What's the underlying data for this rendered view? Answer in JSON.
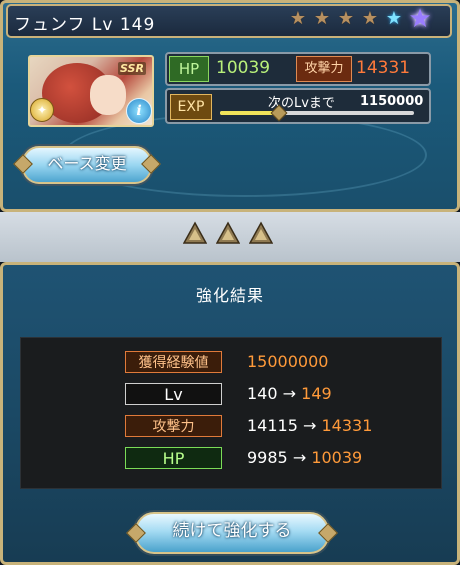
{
  "character": {
    "name": "フュンフ Lv 149",
    "rarity_badge": "SSR",
    "element_icon": "light-orb-icon",
    "info_icon_label": "i"
  },
  "stars": [
    {
      "type": "bronze",
      "glyph": "★"
    },
    {
      "type": "bronze",
      "glyph": "★"
    },
    {
      "type": "bronze",
      "glyph": "★"
    },
    {
      "type": "bronze",
      "glyph": "★"
    },
    {
      "type": "blue",
      "glyph": "★"
    },
    {
      "type": "purple",
      "glyph": "★"
    }
  ],
  "stats": {
    "hp_label": "HP",
    "hp_value": "10039",
    "atk_label": "攻撃力",
    "atk_value": "14331",
    "exp_label": "EXP",
    "next_label": "次のLvまで",
    "next_value": "1150000",
    "exp_progress": 0.3
  },
  "buttons": {
    "base_change": "ベース変更",
    "continue": "続けて強化する"
  },
  "result": {
    "title": "強化結果",
    "rows": [
      {
        "label": "獲得経験値",
        "before": "",
        "after": "15000000"
      },
      {
        "label": "Lv",
        "before": "140",
        "after": "149"
      },
      {
        "label": "攻撃力",
        "before": "14115",
        "after": "14331"
      },
      {
        "label": "HP",
        "before": "9985",
        "after": "10039"
      }
    ],
    "arrow": "→"
  },
  "colors": {
    "accent_orange": "#ff9a3a",
    "hp_green": "#b8f07a",
    "frame_gold": "#c8b37a"
  }
}
